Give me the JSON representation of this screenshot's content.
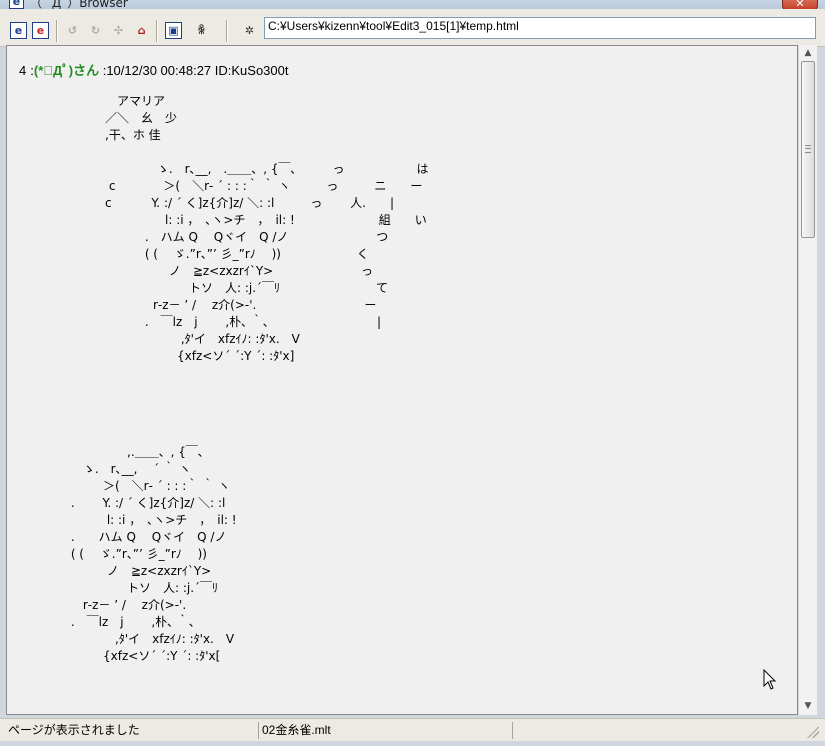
{
  "window": {
    "icon_glyph": "e",
    "title": "（ ´Д`）Browser",
    "close_glyph": "✕"
  },
  "toolbar": {
    "buttons": [
      {
        "id": "ie-open",
        "glyph": "e"
      },
      {
        "id": "ie-open-alt",
        "glyph": "e"
      },
      {
        "id": "back",
        "glyph": "↺"
      },
      {
        "id": "forward",
        "glyph": "↻"
      },
      {
        "id": "stop",
        "glyph": "✣"
      },
      {
        "id": "home",
        "glyph": "⌂"
      },
      {
        "id": "view",
        "glyph": "▣"
      },
      {
        "id": "face",
        "glyph": "ꆜ"
      },
      {
        "id": "settings",
        "glyph": "✲"
      }
    ],
    "address": "C:¥Users¥kizenn¥tool¥Edit3_015[1]¥temp.html"
  },
  "post": {
    "number": "4",
    "separator": ":",
    "name": "(*ﾟДﾟ)さん",
    "meta": ":10/12/30 00:48:27 ID:KuSo300t"
  },
  "aa_block_1": "　アマリア\n／＼　幺　少\n,干、ホ 佳\n\n　　　　 ゝ.　r､__,　.＿＿、, {￣､　　　っ　　　　　　は\n c　　　　＞(　＼r‐ ´ : : :｀ ｀ ヽ　　　っ　　　ニ　　ー\nc　　　 Y. :/ ´ く]z{介]z/ ＼: :l　　　っ　　 人.　　|\n　　　　　l: :i ，　､ヽ>チ　，　il: !　　　　　　　組　　い\n　　　 .　ハム Q　 Qヾイ　Q /ノ　　　　　　　 つ\n　　　 ( (　 ゞ.”r、”’ 彡_”rﾉ　 ))　　　　　　 く\n　　　　　 ノ　≧z<zxzrｲ`Y>　　　　　　　 っ\n　　　　　　　トソ　人: :j.´￣ﾘ　　　　　　　　て\n　　　　r‐z－ ’ /　 z介(>‐'.　　　　　　　　　ー\n　　　 .　￣lz　j　　 ,朴､ ｀､　　　　　　　　　|\n　　　　　　 ,ﾀ'イ　xfzｲﾉ: :ﾀ'x.　V\n　　　　　　{xfz<ソ´ ´:Y ´: :ﾀ'x]",
  "aa_block_2": "　　　　　　,.＿＿、, {￣､\n　　 ゝ.　r､__,　 ´ ｀ ヽ\n　　　　＞(　＼r‐ ´ : : :｀ ｀ ヽ\n　 .　　 Y. :/ ´ く]z{介]z/ ＼: :l\n　　　　 l: :i ，　､ヽ>チ　，　il: !\n　 .　　ハム Q　 Qヾイ　Q /ノ\n　 ( (　 ゞ.”r、”’ 彡_”rﾉ　 ))\n　　　　 ノ　≧z<zxzrｲ`Y>\n　　　　　　トソ　人: :j.´￣ﾘ\n　　 r‐z－ ’ /　 z介(>‐'.\n　 .　￣lz　j　　 ,朴､ ｀､\n　　　　　,ﾀ'イ　xfzｲﾉ: :ﾀ'x.　V\n　　　　{xfz<ソ´ ´:Y ´: :ﾀ'x[",
  "status": {
    "left": "ページが表示されました",
    "middle": "02金糸雀.mlt"
  },
  "scrollbar": {
    "up_glyph": "▲",
    "down_glyph": "▼"
  }
}
